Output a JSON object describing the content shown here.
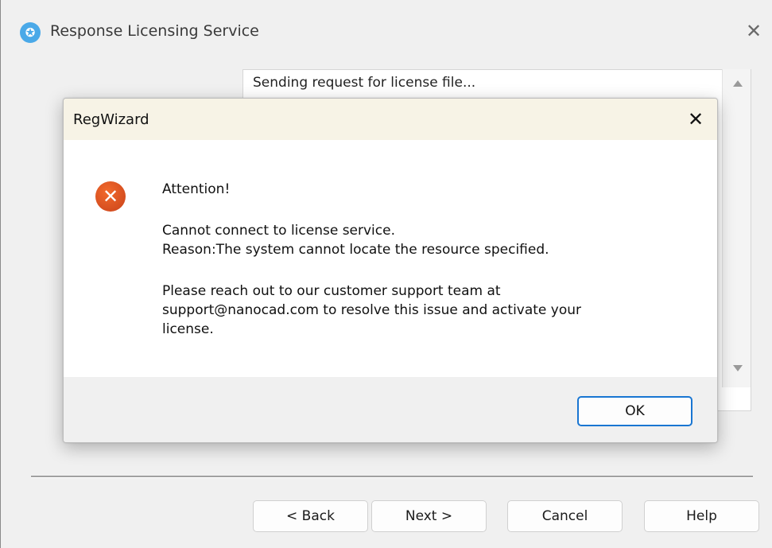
{
  "back_window": {
    "title": "Response Licensing Service",
    "app_icon_glyph": "✪",
    "close_glyph": "✕",
    "log": {
      "line1": "Sending request for license file...",
      "line2": "—"
    },
    "buttons": {
      "back": "< Back",
      "next": "Next >",
      "cancel": "Cancel",
      "help": "Help"
    }
  },
  "dialog": {
    "title": "RegWizard",
    "close_glyph": "✕",
    "error_glyph": "✕",
    "message": {
      "attention": "Attention!",
      "line1": "Cannot connect to license service.",
      "line2": "Reason:The system cannot locate the resource specified.",
      "line3": "Please reach out to our customer support team at",
      "line4": "support@nanocad.com to resolve this issue and activate your",
      "line5": "license."
    },
    "ok_label": "OK"
  },
  "colors": {
    "error_icon": "#d9531e",
    "app_icon": "#4aa9e8",
    "dialog_titlebar": "#f7f3e6",
    "ok_border": "#1976d2"
  }
}
